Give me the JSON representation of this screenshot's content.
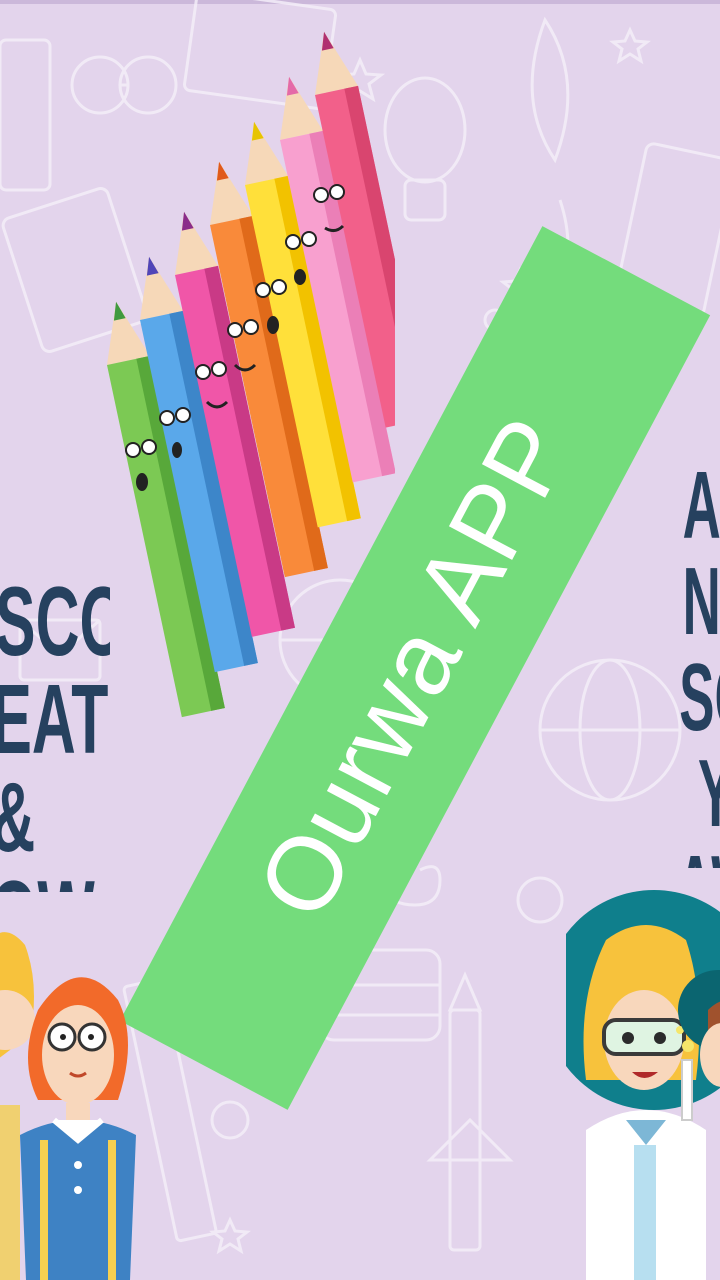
{
  "app": {
    "title": "Ourwa APP"
  },
  "left_panel": {
    "lines": [
      "SCOVER",
      "EATE &",
      "OW"
    ]
  },
  "right_panel": {
    "lines": [
      "A N",
      "SCH",
      "Y",
      "AWA"
    ]
  },
  "colors": {
    "background": "#e3d4ec",
    "banner": "#74dc7c",
    "banner_text": "#ffffff",
    "side_text": "#26415f",
    "doodle": "#f4eef8"
  },
  "icons": [
    "pencils-illustration",
    "kid-illustration",
    "scientist-illustration",
    "doodle-background"
  ]
}
